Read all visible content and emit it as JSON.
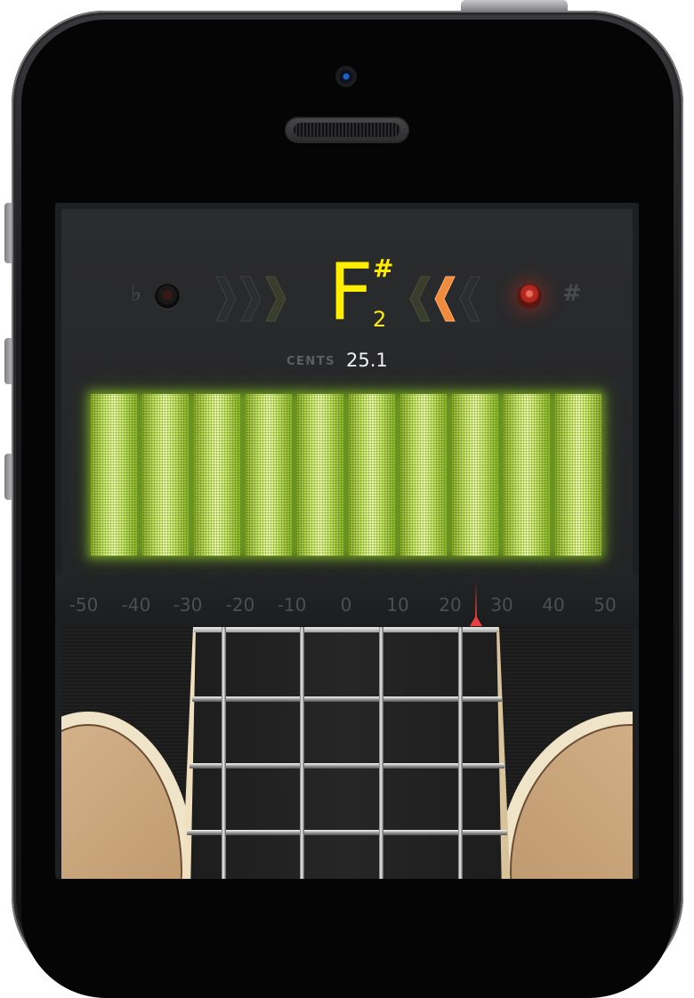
{
  "tuner": {
    "note": "F",
    "accidental": "#",
    "octave": "2",
    "flat_symbol": "♭",
    "sharp_symbol": "#",
    "cents_label": "CENTS",
    "cents_value": "25.1",
    "active_indicator": "sharp",
    "meter_bar_color": "#c8ea66",
    "note_color": "#ffee00"
  },
  "scale": {
    "labels": [
      "-50",
      "-40",
      "-30",
      "-20",
      "-10",
      "0",
      "10",
      "20",
      "30",
      "40",
      "50"
    ],
    "needle_value": 25.1
  },
  "strings_count": 4,
  "frets_count": 3
}
